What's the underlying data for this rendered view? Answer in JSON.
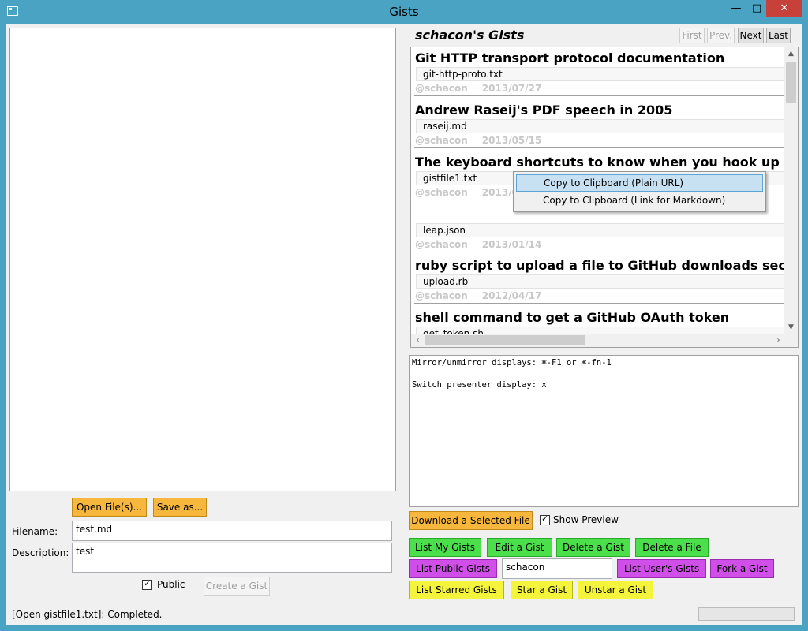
{
  "window": {
    "title": "Gists"
  },
  "editor": {
    "open_label": "Open File(s)...",
    "save_label": "Save as...",
    "filename_label": "Filename:",
    "filename_value": "test.md",
    "description_label": "Description:",
    "description_value": "test",
    "public_label": "Public",
    "public_checked": true,
    "create_label": "Create a Gist"
  },
  "gists": {
    "title": "schacon's Gists",
    "nav": {
      "first": "First",
      "prev": "Prev.",
      "next": "Next",
      "last": "Last"
    },
    "items": [
      {
        "title": "Git HTTP transport protocol documentation",
        "file": "git-http-proto.txt",
        "user": "@schacon",
        "date": "2013/07/27"
      },
      {
        "title": "Andrew Raseij's PDF speech in 2005",
        "file": "raseij.md",
        "user": "@schacon",
        "date": "2013/05/15"
      },
      {
        "title": "The keyboard shortcuts to know when you hook up you",
        "file": "gistfile1.txt",
        "user": "@schacon",
        "date": "2013/0"
      },
      {
        "title": "",
        "file": "leap.json",
        "user": "@schacon",
        "date": "2013/01/14"
      },
      {
        "title": "ruby script to upload a file to GitHub downloads section",
        "file": "upload.rb",
        "user": "@schacon",
        "date": "2012/04/17"
      },
      {
        "title": "shell command to get a GitHub OAuth token",
        "file": "get_token.sh",
        "user": "",
        "date": ""
      }
    ]
  },
  "context_menu": {
    "items": [
      {
        "label": "Copy to Clipboard (Plain URL)",
        "highlighted": true
      },
      {
        "label": "Copy to Clipboard (Link for Markdown)",
        "highlighted": false
      }
    ]
  },
  "preview": {
    "text": "Mirror/unmirror displays: ⌘-F1 or ⌘-fn-1\n\nSwitch presenter display: x"
  },
  "actions": {
    "download_label": "Download a Selected File",
    "show_preview_label": "Show Preview",
    "show_preview_checked": true,
    "list_my": "List My Gists",
    "edit": "Edit a Gist",
    "delete_gist": "Delete a Gist",
    "delete_file": "Delete a File",
    "list_public": "List Public Gists",
    "user_value": "schacon",
    "list_user": "List User's Gists",
    "fork": "Fork a Gist",
    "list_starred": "List Starred Gists",
    "star": "Star a Gist",
    "unstar": "Unstar a Gist"
  },
  "status": {
    "text": "[Open gistfile1.txt]: Completed."
  },
  "colors": {
    "titlebar": "#4ba3c3",
    "close": "#c7413a",
    "orange": "#f6b73c",
    "green": "#4be04b",
    "purple": "#d04fe8",
    "yellow": "#f4f43c",
    "menu_highlight": "#c7e0f2"
  },
  "icons": {
    "app": "window-icon",
    "minimize": "minimize-icon",
    "maximize": "maximize-icon",
    "close": "close-icon"
  }
}
